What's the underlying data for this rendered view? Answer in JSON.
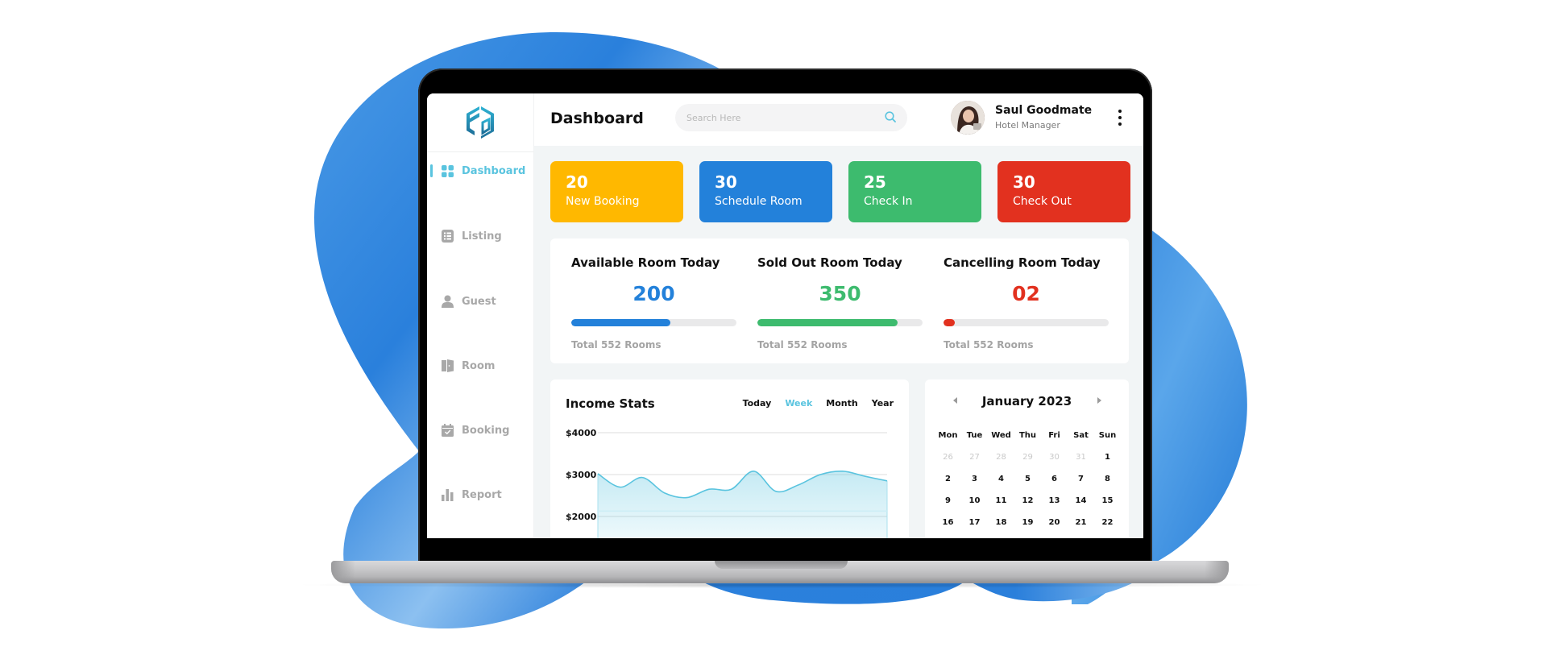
{
  "app": {
    "brand_logo": "ea-hexagon-logo",
    "colors": {
      "accent": "#5ac4df",
      "yellow": "#ffb800",
      "blue": "#2381da",
      "green": "#3dbb6e",
      "red": "#e2311f",
      "background_blob": "#2d84dd"
    }
  },
  "sidebar": {
    "items": [
      {
        "label": "Dashboard",
        "icon": "grid-icon",
        "active": true
      },
      {
        "label": "Listing",
        "icon": "list-icon",
        "active": false
      },
      {
        "label": "Guest",
        "icon": "user-icon",
        "active": false
      },
      {
        "label": "Room",
        "icon": "door-icon",
        "active": false
      },
      {
        "label": "Booking",
        "icon": "calendar-check-icon",
        "active": false
      },
      {
        "label": "Report",
        "icon": "bar-chart-icon",
        "active": false
      }
    ]
  },
  "header": {
    "title": "Dashboard",
    "search_placeholder": "Search Here",
    "search_value": "",
    "user": {
      "name": "Saul Goodmate",
      "role": "Hotel Manager"
    }
  },
  "stat_cards": [
    {
      "value": "20",
      "label": "New Booking",
      "color": "#ffb800"
    },
    {
      "value": "30",
      "label": "Schedule Room",
      "color": "#2381da"
    },
    {
      "value": "25",
      "label": "Check In",
      "color": "#3dbb6e"
    },
    {
      "value": "30",
      "label": "Check Out",
      "color": "#e2311f"
    }
  ],
  "rooms": [
    {
      "title": "Available Room Today",
      "value": "200",
      "total": "Total 552 Rooms",
      "progress": 0.6,
      "color": "#2381da"
    },
    {
      "title": "Sold Out Room Today",
      "value": "350",
      "total": "Total 552 Rooms",
      "progress": 0.85,
      "color": "#3dbb6e"
    },
    {
      "title": "Cancelling Room Today",
      "value": "02",
      "total": "Total 552 Rooms",
      "progress": 0.07,
      "color": "#e2311f"
    }
  ],
  "income": {
    "title": "Income Stats",
    "tabs": [
      "Today",
      "Week",
      "Month",
      "Year"
    ],
    "active_tab": "Week",
    "chart_data": {
      "type": "area",
      "title": "Income Stats",
      "xlabel": "",
      "ylabel": "",
      "ytick_labels": [
        "$4000",
        "$3000",
        "$2000"
      ],
      "yticks": [
        4000,
        3000,
        2000
      ],
      "ylim": [
        1700,
        4200
      ],
      "x": [
        0,
        1,
        2,
        3,
        4,
        5,
        6,
        7,
        8,
        9,
        10,
        11,
        12,
        13
      ],
      "values": [
        3020,
        2700,
        2930,
        2560,
        2450,
        2650,
        2650,
        3080,
        2600,
        2750,
        3000,
        3080,
        2960,
        2850
      ],
      "line_color": "#5ac4df",
      "grid": true
    }
  },
  "calendar": {
    "title": "January 2023",
    "weekdays": [
      "Mon",
      "Tue",
      "Wed",
      "Thu",
      "Fri",
      "Sat",
      "Sun"
    ],
    "weeks": [
      [
        {
          "d": "26",
          "m": true
        },
        {
          "d": "27",
          "m": true
        },
        {
          "d": "28",
          "m": true
        },
        {
          "d": "29",
          "m": true
        },
        {
          "d": "30",
          "m": true
        },
        {
          "d": "31",
          "m": true
        },
        {
          "d": "1",
          "m": false
        }
      ],
      [
        {
          "d": "2",
          "m": false
        },
        {
          "d": "3",
          "m": false
        },
        {
          "d": "4",
          "m": false
        },
        {
          "d": "5",
          "m": false
        },
        {
          "d": "6",
          "m": false
        },
        {
          "d": "7",
          "m": false
        },
        {
          "d": "8",
          "m": false
        }
      ],
      [
        {
          "d": "9",
          "m": false
        },
        {
          "d": "10",
          "m": false
        },
        {
          "d": "11",
          "m": false
        },
        {
          "d": "12",
          "m": false
        },
        {
          "d": "13",
          "m": false
        },
        {
          "d": "14",
          "m": false
        },
        {
          "d": "15",
          "m": false
        }
      ],
      [
        {
          "d": "16",
          "m": false
        },
        {
          "d": "17",
          "m": false
        },
        {
          "d": "18",
          "m": false
        },
        {
          "d": "19",
          "m": false
        },
        {
          "d": "20",
          "m": false
        },
        {
          "d": "21",
          "m": false
        },
        {
          "d": "22",
          "m": false
        }
      ]
    ]
  }
}
